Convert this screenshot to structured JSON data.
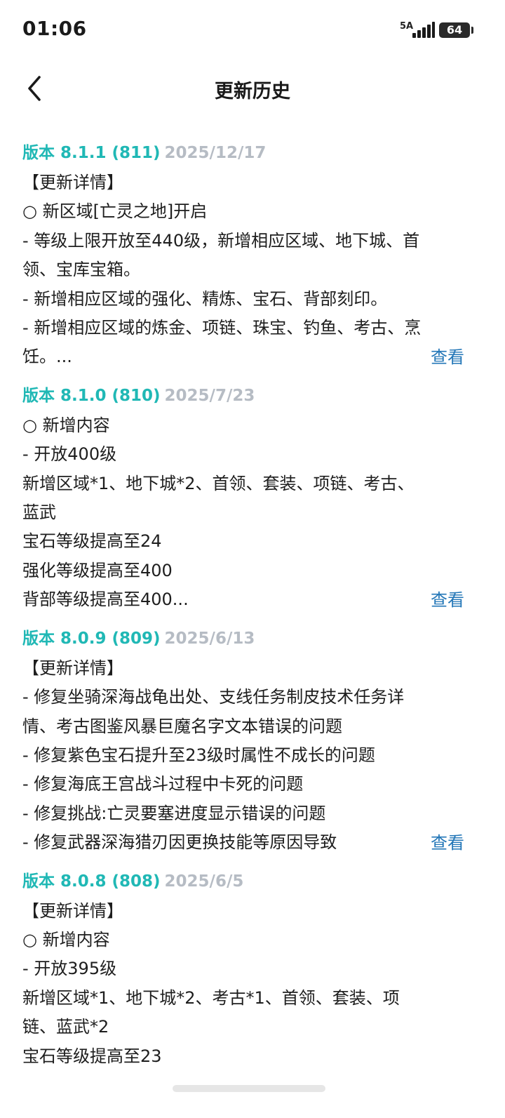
{
  "status_bar": {
    "time": "01:06",
    "network": "5A",
    "battery": "64"
  },
  "header": {
    "title": "更新历史"
  },
  "entries": [
    {
      "version": "版本 8.1.1 (811)",
      "date": "2025/12/17",
      "lines": [
        "【更新详情】",
        "○ 新区域[亡灵之地]开启",
        "- 等级上限开放至440级，新增相应区域、地下城、首",
        "领、宝库宝箱。",
        "- 新增相应区域的强化、精炼、宝石、背部刻印。",
        "- 新增相应区域的炼金、项链、珠宝、钓鱼、考古、烹",
        "饪。..."
      ],
      "view_label": "查看"
    },
    {
      "version": "版本 8.1.0 (810)",
      "date": "2025/7/23",
      "lines": [
        "○ 新增内容",
        "- 开放400级",
        "新增区域*1、地下城*2、首领、套装、项链、考古、",
        "蓝武",
        "宝石等级提高至24",
        "强化等级提高至400",
        "背部等级提高至400..."
      ],
      "view_label": "查看"
    },
    {
      "version": "版本 8.0.9 (809)",
      "date": "2025/6/13",
      "lines": [
        "【更新详情】",
        "- 修复坐骑深海战龟出处、支线任务制皮技术任务详",
        "情、考古图鉴风暴巨魔名字文本错误的问题",
        "- 修复紫色宝石提升至23级时属性不成长的问题",
        "- 修复海底王宫战斗过程中卡死的问题",
        "- 修复挑战:亡灵要塞进度显示错误的问题",
        "- 修复武器深海猎刃因更换技能等原因导致"
      ],
      "view_label": "查看"
    },
    {
      "version": "版本 8.0.8 (808)",
      "date": "2025/6/5",
      "lines": [
        "【更新详情】",
        "○ 新增内容",
        "- 开放395级",
        "新增区域*1、地下城*2、考古*1、首领、套装、项",
        "链、蓝武*2",
        "宝石等级提高至23"
      ],
      "view_label": ""
    }
  ]
}
